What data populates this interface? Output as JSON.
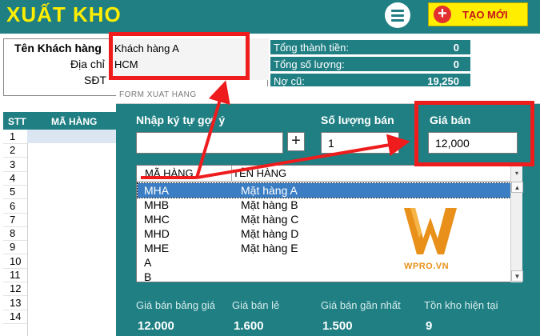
{
  "header": {
    "title": "XUẤT KHO",
    "new_button_label": "TẠO MỚI",
    "new_button_icon": "+"
  },
  "customer": {
    "name_label": "Tên Khách hàng",
    "name_value": "Khách hàng A",
    "address_label": "Địa chỉ",
    "address_value": "HCM",
    "phone_label": "SĐT"
  },
  "summary": [
    {
      "label": "Tổng thành tiền:",
      "value": "0"
    },
    {
      "label": "Tổng số lượng:",
      "value": "0"
    },
    {
      "label": "Nợ cũ:",
      "value": "19,250"
    }
  ],
  "sheet": {
    "col_stt": "STT",
    "col_code": "MÃ HÀNG",
    "row_numbers": [
      "1",
      "2",
      "3",
      "4",
      "5",
      "6",
      "7",
      "8",
      "9",
      "10",
      "11",
      "12",
      "13",
      "14"
    ]
  },
  "form": {
    "title": "FORM XUAT HANG",
    "search_label": "Nhập ký tự gợi ý",
    "search_value": "",
    "plus_label": "+",
    "qty_label": "Số lượng bán",
    "qty_value": "1",
    "price_label": "Giá bán",
    "price_value": "12,000",
    "list": {
      "col_code": "MÃ HÀNG",
      "col_name": "TÊN HÀNG",
      "rows": [
        {
          "code": "MHA",
          "name": "Mặt hàng A"
        },
        {
          "code": "MHB",
          "name": "Mặt hàng B"
        },
        {
          "code": "MHC",
          "name": "Mặt hàng C"
        },
        {
          "code": "MHD",
          "name": "Mặt hàng D"
        },
        {
          "code": "MHE",
          "name": "Mặt hàng E"
        },
        {
          "code": "A",
          "name": ""
        },
        {
          "code": "B",
          "name": ""
        }
      ],
      "selected_index": 0
    },
    "logo_text": "WPRO.VN",
    "stats": [
      {
        "label": "Giá bán bảng giá",
        "value": "12.000"
      },
      {
        "label": "Giá bán lẻ",
        "value": "1.600"
      },
      {
        "label": "Giá bán gần nhất",
        "value": "1.500"
      },
      {
        "label": "Tồn kho hiện tại",
        "value": "9"
      }
    ]
  },
  "colors": {
    "teal": "#1f7f83",
    "yellow": "#ffee00",
    "annotation_red": "#ee1c1c",
    "selection_blue": "#3b7ec4",
    "logo_orange": "#e8901a"
  },
  "icons": [
    "hamburger-menu-icon",
    "plus-circle-icon",
    "wpro-logo-icon"
  ]
}
